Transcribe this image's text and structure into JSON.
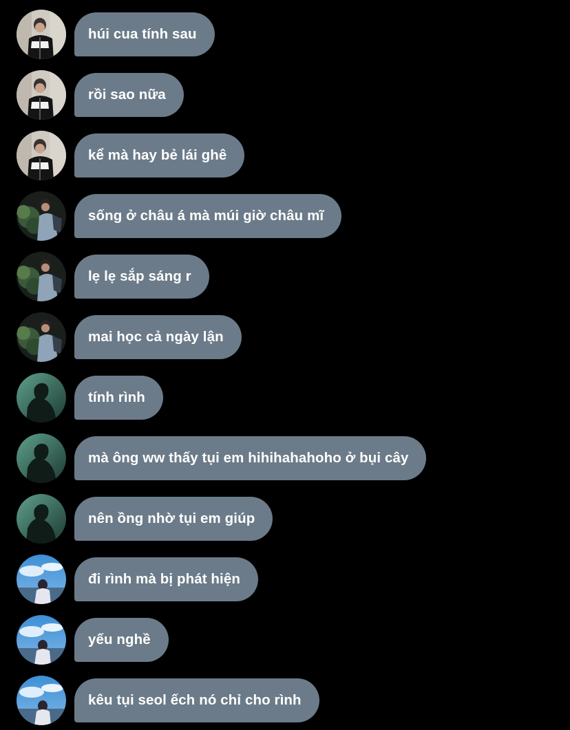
{
  "messages": [
    {
      "text": "húi cua tính sau",
      "avatar": "avatar-boy-black-jacket"
    },
    {
      "text": "rồi sao nữa",
      "avatar": "avatar-boy-black-jacket"
    },
    {
      "text": "kể mà hay bẻ lái ghê",
      "avatar": "avatar-boy-black-jacket"
    },
    {
      "text": "sống ở châu á mà múi giờ châu mĩ",
      "avatar": "avatar-boy-tree-night"
    },
    {
      "text": "lẹ lẹ sắp sáng r",
      "avatar": "avatar-boy-tree-night"
    },
    {
      "text": "mai học cả ngày lận",
      "avatar": "avatar-boy-tree-night"
    },
    {
      "text": "tính rình",
      "avatar": "avatar-silhouette-teal"
    },
    {
      "text": "mà ông ww thấy tụi em hihihahahoho ở bụi cây",
      "avatar": "avatar-silhouette-teal"
    },
    {
      "text": "nên ồng nhờ tụi em giúp",
      "avatar": "avatar-silhouette-teal"
    },
    {
      "text": "đi rình mà bị phát hiện",
      "avatar": "avatar-girl-blue-sky"
    },
    {
      "text": "yếu nghề",
      "avatar": "avatar-girl-blue-sky"
    },
    {
      "text": "kêu tụi seol ếch nó chỉ cho rình",
      "avatar": "avatar-girl-blue-sky"
    }
  ],
  "colors": {
    "background": "#000000",
    "bubble": "#6b7b89",
    "text": "#ffffff"
  }
}
